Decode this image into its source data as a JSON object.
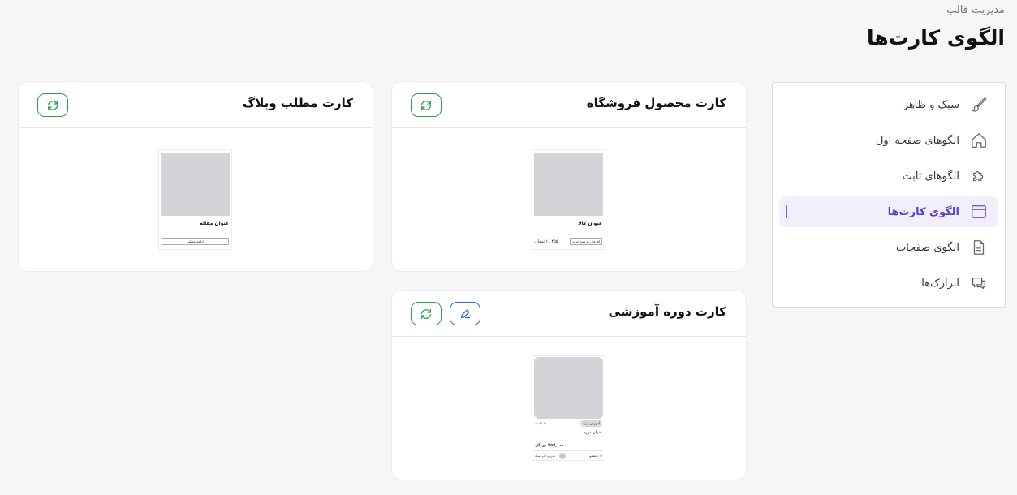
{
  "header": {
    "breadcrumb": "مدیریت قالب",
    "title": "الگوی کارت‌ها"
  },
  "sidebar": {
    "items": [
      {
        "label": "سبک و ظاهر",
        "icon": "brush-icon"
      },
      {
        "label": "الگوهای صفحه اول",
        "icon": "home-icon"
      },
      {
        "label": "الگوهای ثابت",
        "icon": "puzzle-icon"
      },
      {
        "label": "الگوی کارت‌ها",
        "icon": "window-icon",
        "active": true
      },
      {
        "label": "الگوی صفحات",
        "icon": "document-icon"
      },
      {
        "label": "ابزارک‌ها",
        "icon": "chat-icon"
      }
    ]
  },
  "cards": {
    "product": {
      "title": "کارت محصول فروشگاه",
      "preview_title": "عنوان کالا",
      "preview_price": "۱۰,۴۵۵ تومان",
      "preview_button": "افزودن به سبد خرید"
    },
    "blog": {
      "title": "کارت مطلب وبلاگ",
      "preview_title": "عنوان مقاله",
      "preview_button": "ادامه مطلب"
    },
    "course": {
      "title": "کارت دوره آموزشی",
      "preview_badge": "آموزش ویژه",
      "preview_meta": "۱۰ جلسه",
      "preview_title": "عنوان دوره",
      "preview_price": "۷۵۷,۰۰۰ تومان",
      "preview_teacher": "مدرس: نام استاد",
      "preview_students": "۱۲ دانشجو"
    }
  },
  "colors": {
    "accent": "#7b5ce6",
    "refresh": "#2aa048",
    "edit": "#2f67d8"
  }
}
